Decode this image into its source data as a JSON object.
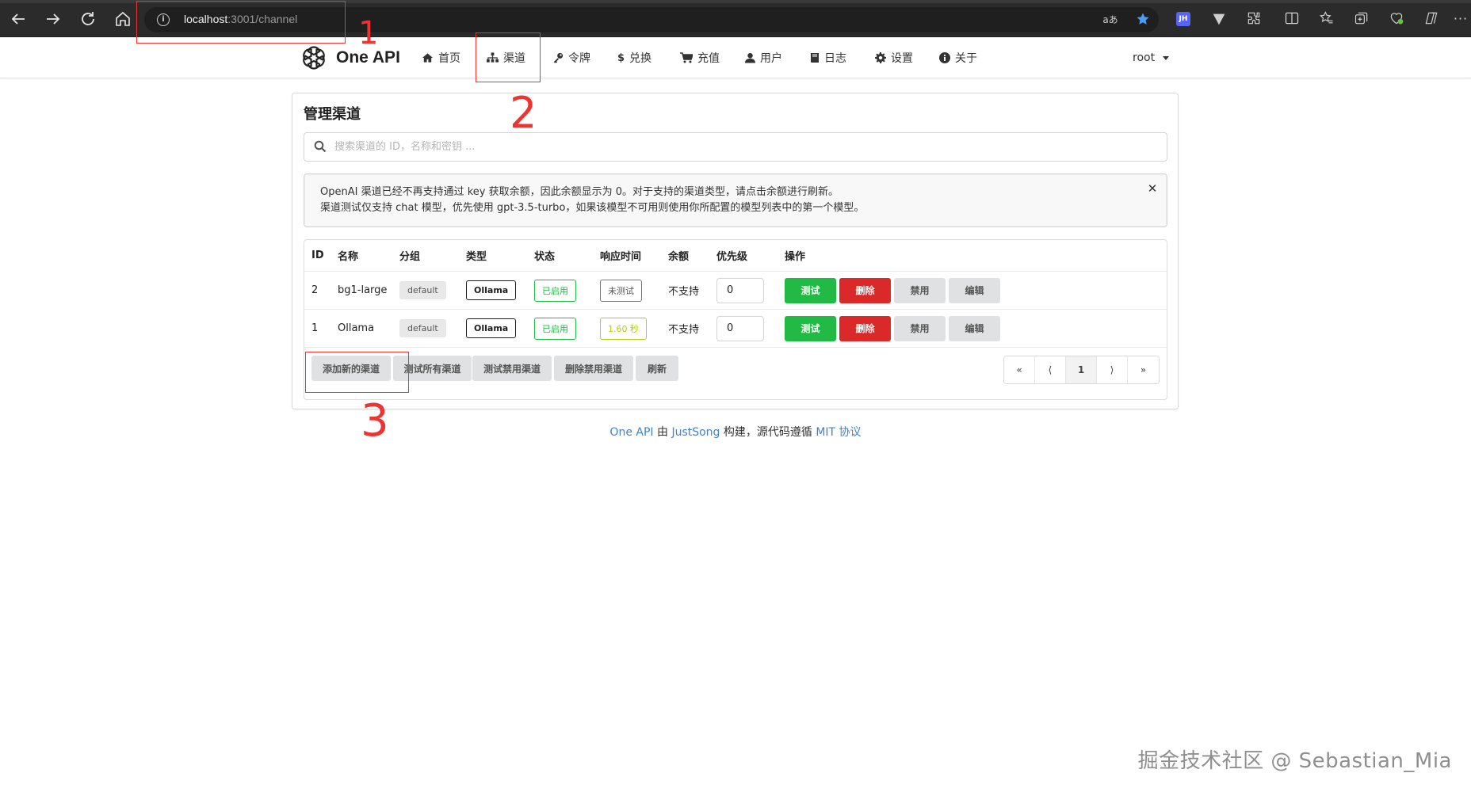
{
  "browser": {
    "url_host": "localhost",
    "url_path": ":3001/channel",
    "translate_icon": "aあ"
  },
  "app": {
    "brand": "One API",
    "menu": [
      {
        "label": "首页",
        "icon": "home-icon"
      },
      {
        "label": "渠道",
        "icon": "sitemap-icon"
      },
      {
        "label": "令牌",
        "icon": "key-icon"
      },
      {
        "label": "兑换",
        "icon": "dollar-icon"
      },
      {
        "label": "充值",
        "icon": "cart-icon"
      },
      {
        "label": "用户",
        "icon": "user-icon"
      },
      {
        "label": "日志",
        "icon": "book-icon"
      },
      {
        "label": "设置",
        "icon": "gear-icon"
      },
      {
        "label": "关于",
        "icon": "info-icon"
      }
    ],
    "user": "root"
  },
  "page": {
    "title": "管理渠道",
    "search_placeholder": "搜索渠道的 ID，名称和密钥 ...",
    "notice_line1": "OpenAI 渠道已经不再支持通过 key 获取余额，因此余额显示为 0。对于支持的渠道类型，请点击余额进行刷新。",
    "notice_line2": "渠道测试仅支持 chat 模型，优先使用 gpt-3.5-turbo，如果该模型不可用则使用你所配置的模型列表中的第一个模型。"
  },
  "table": {
    "headers": [
      "ID",
      "名称",
      "分组",
      "类型",
      "状态",
      "响应时间",
      "余额",
      "优先级",
      "操作"
    ],
    "rows": [
      {
        "id": "2",
        "name": "bg1-large",
        "group": "default",
        "type": "Ollama",
        "status": "已启用",
        "response": "未测试",
        "balance": "不支持",
        "priority": "0"
      },
      {
        "id": "1",
        "name": "Ollama",
        "group": "default",
        "type": "Ollama",
        "status": "已启用",
        "response": "1.60 秒",
        "balance": "不支持",
        "priority": "0"
      }
    ],
    "row_actions": {
      "test": "测试",
      "delete": "删除",
      "disable": "禁用",
      "edit": "编辑"
    }
  },
  "actions": {
    "add": "添加新的渠道",
    "test_all": "测试所有渠道",
    "test_disabled": "测试禁用渠道",
    "delete_disabled": "删除禁用渠道",
    "refresh": "刷新"
  },
  "pagination": {
    "first": "«",
    "prev": "⟨",
    "current": "1",
    "next": "⟩",
    "last": "»"
  },
  "footer": {
    "project": "One API",
    "by": "由",
    "author": "JustSong",
    "text": "构建，源代码遵循",
    "license": "MIT 协议"
  },
  "annotations": [
    "1",
    "2",
    "3"
  ],
  "watermark": "掘金技术社区 @ Sebastian_Mia",
  "colors": {
    "green": "#21ba45",
    "red": "#db2828",
    "olive": "#b5cc18",
    "link": "#4183c4",
    "annotation": "#e33333"
  }
}
